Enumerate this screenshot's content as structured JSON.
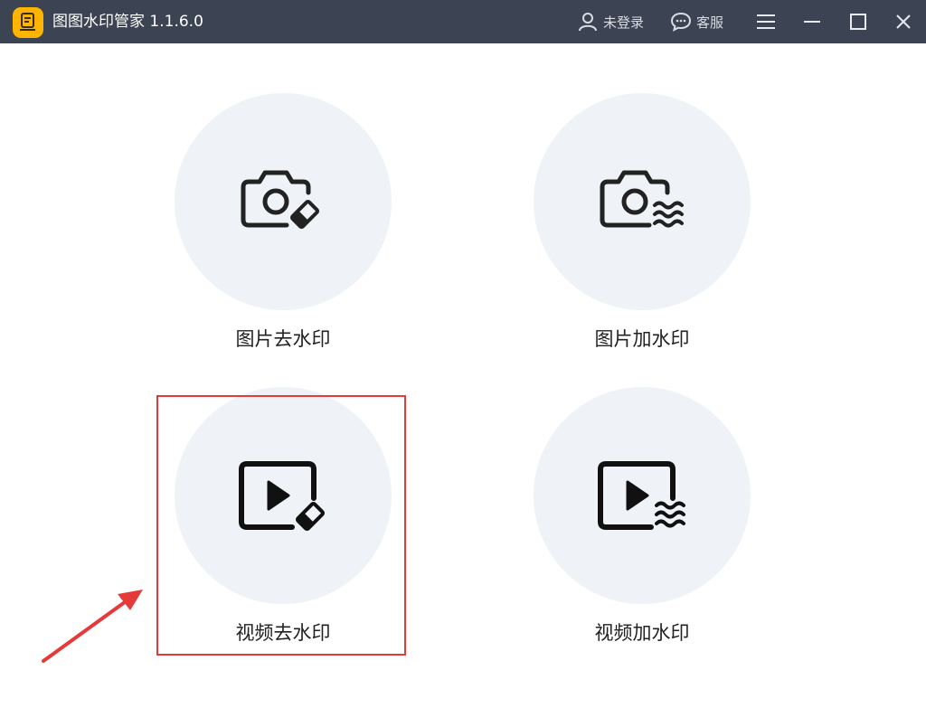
{
  "app": {
    "title": "图图水印管家  1.1.6.0",
    "logo_icon": "app-logo-icon"
  },
  "titlebar": {
    "login_label": "未登录",
    "service_label": "客服"
  },
  "features": [
    {
      "label": "图片去水印",
      "icon": "camera-eraser-icon"
    },
    {
      "label": "图片加水印",
      "icon": "camera-waves-icon"
    },
    {
      "label": "视频去水印",
      "icon": "video-eraser-icon"
    },
    {
      "label": "视频加水印",
      "icon": "video-waves-icon"
    }
  ],
  "colors": {
    "titlebar": "#3c4453",
    "accent": "#ffb400",
    "circle": "#eff2f7",
    "annotation": "#e53a3a"
  }
}
